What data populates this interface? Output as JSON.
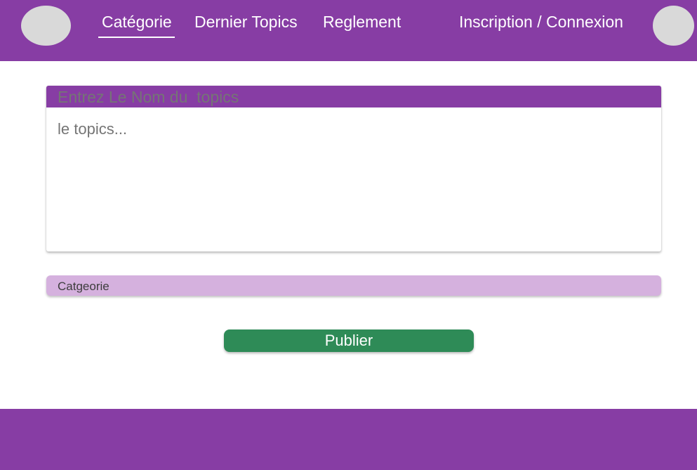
{
  "header": {
    "background_color": "#873da4",
    "nav": {
      "categorie": "Catégorie",
      "dernier_topics": "Dernier Topics",
      "reglement": "Reglement",
      "auth": "Inscription / Connexion"
    },
    "active_nav": "categorie"
  },
  "topic_form": {
    "title_placeholder": "Entrez Le Nom du  topics",
    "body_placeholder": "le topics...",
    "category_label": "Catgeorie",
    "category_color": "#d5b1de",
    "publish_label": "Publier",
    "publish_color": "#2e8b57"
  },
  "footer": {
    "background_color": "#873da4"
  }
}
